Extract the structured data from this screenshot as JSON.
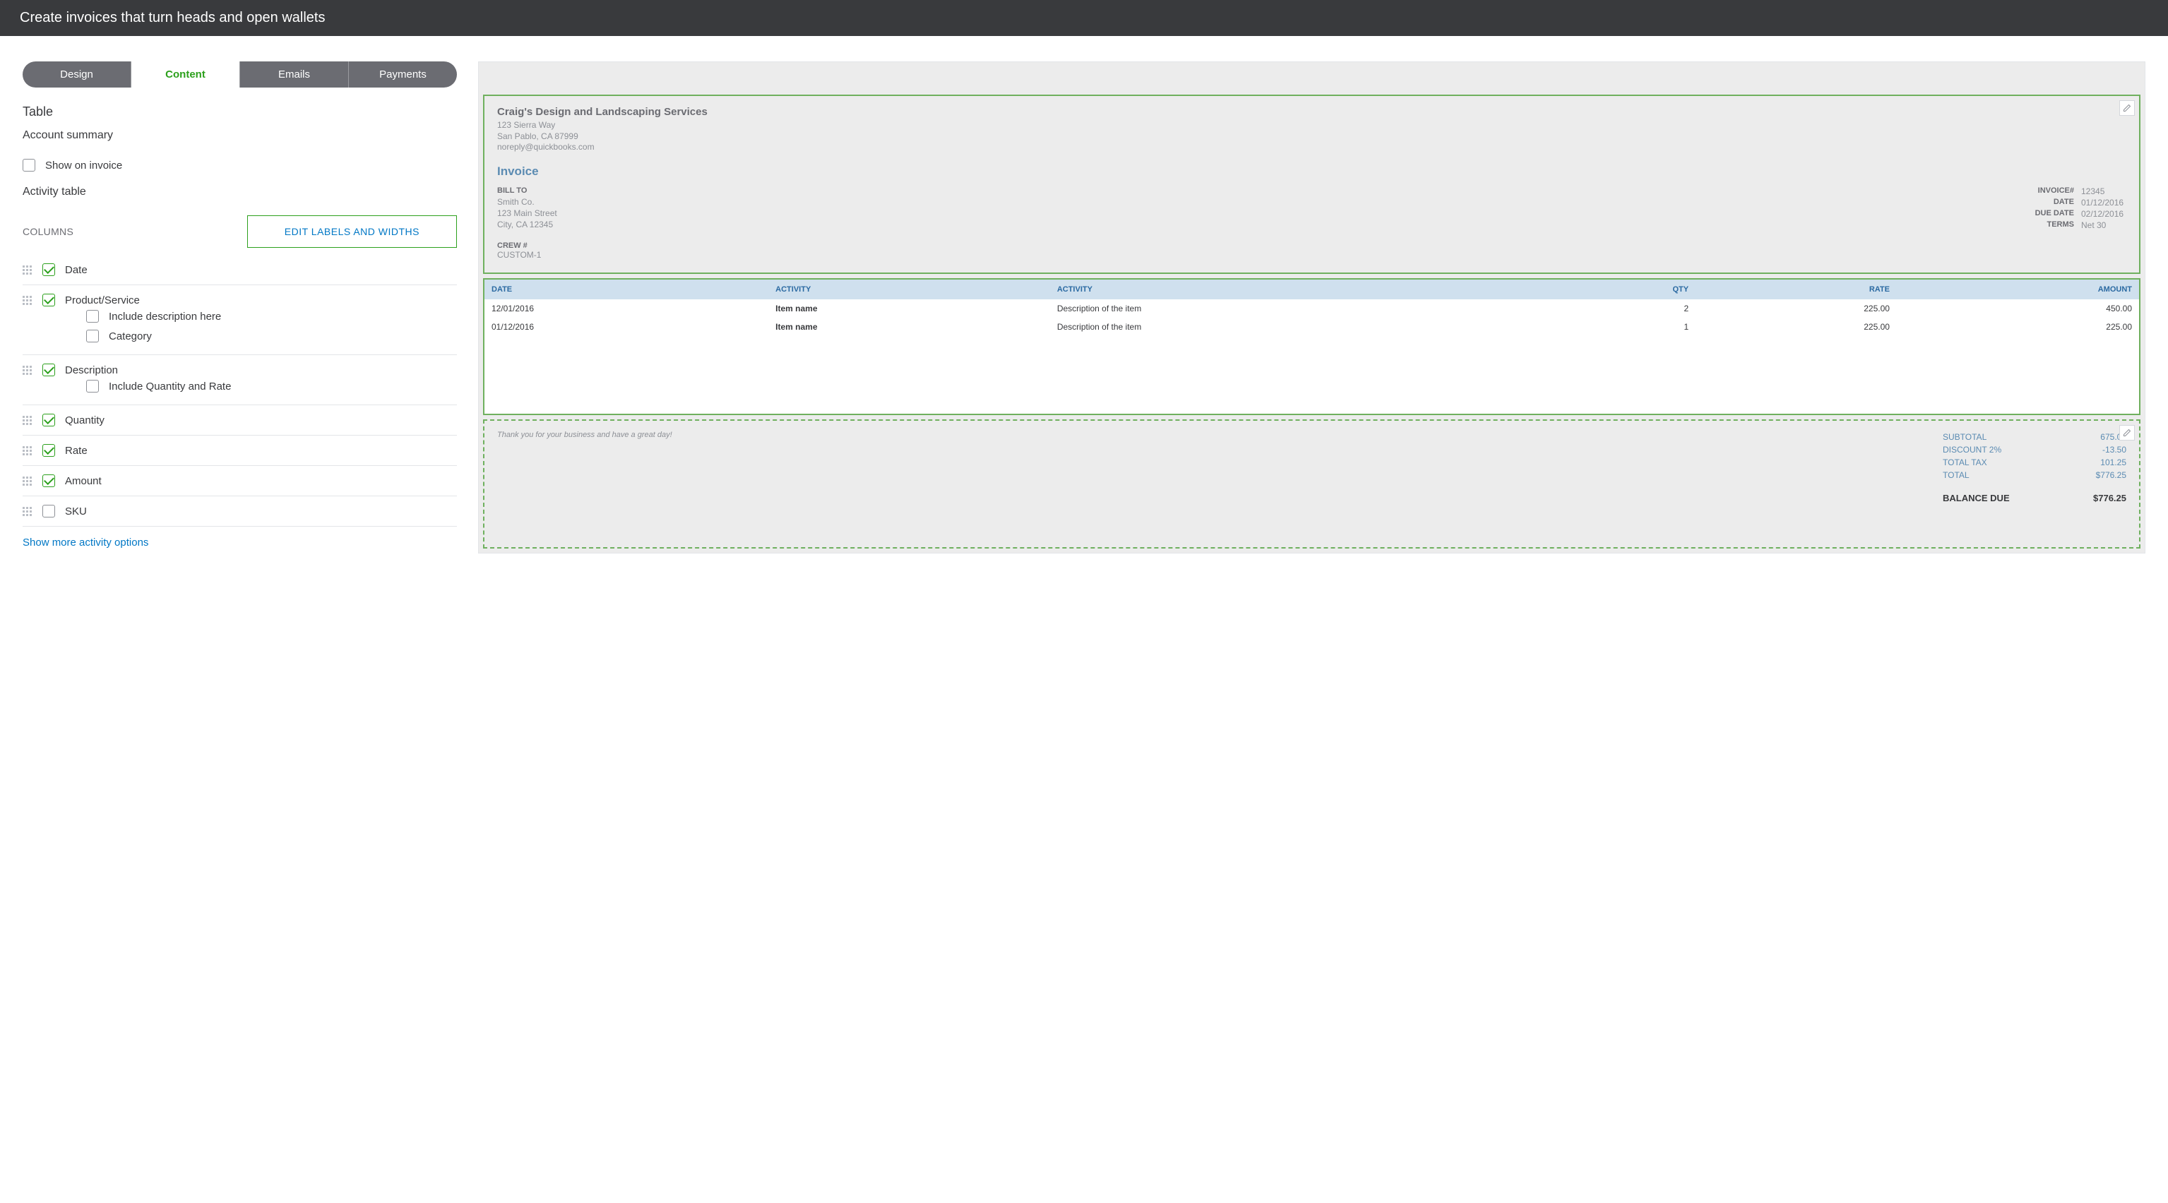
{
  "header": {
    "title": "Create invoices that turn heads and open wallets"
  },
  "tabs": {
    "design": "Design",
    "content": "Content",
    "emails": "Emails",
    "payments": "Payments"
  },
  "left": {
    "table": "Table",
    "account_summary": "Account summary",
    "show_on_invoice": "Show on invoice",
    "activity_table": "Activity table",
    "columns": "COLUMNS",
    "edit_labels": "EDIT LABELS AND WIDTHS",
    "cols": {
      "date": "Date",
      "product": "Product/Service",
      "include_desc": "Include description here",
      "category": "Category",
      "description": "Description",
      "include_qty_rate": "Include Quantity and Rate",
      "quantity": "Quantity",
      "rate": "Rate",
      "amount": "Amount",
      "sku": "SKU"
    },
    "show_more": "Show more activity options"
  },
  "preview": {
    "company": "Craig's Design and Landscaping Services",
    "addr1": "123 Sierra Way",
    "addr2": "San Pablo, CA 87999",
    "email": "noreply@quickbooks.com",
    "invoice": "Invoice",
    "billto_label": "BILL TO",
    "billto_name": "Smith Co.",
    "billto_addr1": "123 Main Street",
    "billto_addr2": "City, CA 12345",
    "invoice_no_label": "INVOICE#",
    "invoice_no": "12345",
    "date_label": "DATE",
    "date": "01/12/2016",
    "due_label": "DUE DATE",
    "due": "02/12/2016",
    "terms_label": "TERMS",
    "terms": "Net 30",
    "crew_label": "CREW #",
    "crew": "CUSTOM-1",
    "table": {
      "h_date": "DATE",
      "h_act1": "ACTIVITY",
      "h_act2": "ACTIVITY",
      "h_qty": "QTY",
      "h_rate": "RATE",
      "h_amount": "AMOUNT",
      "rows": [
        {
          "date": "12/01/2016",
          "item": "Item name",
          "desc": "Description of the item",
          "qty": "2",
          "rate": "225.00",
          "amount": "450.00"
        },
        {
          "date": "01/12/2016",
          "item": "Item name",
          "desc": "Description of the item",
          "qty": "1",
          "rate": "225.00",
          "amount": "225.00"
        }
      ]
    },
    "footer_msg": "Thank you for your business and have a great day!",
    "totals": {
      "subtotal_l": "SUBTOTAL",
      "subtotal_v": "675.00",
      "discount_l": "DISCOUNT 2%",
      "discount_v": "-13.50",
      "tax_l": "TOTAL TAX",
      "tax_v": "101.25",
      "total_l": "TOTAL",
      "total_v": "$776.25",
      "balance_l": "BALANCE DUE",
      "balance_v": "$776.25"
    }
  }
}
